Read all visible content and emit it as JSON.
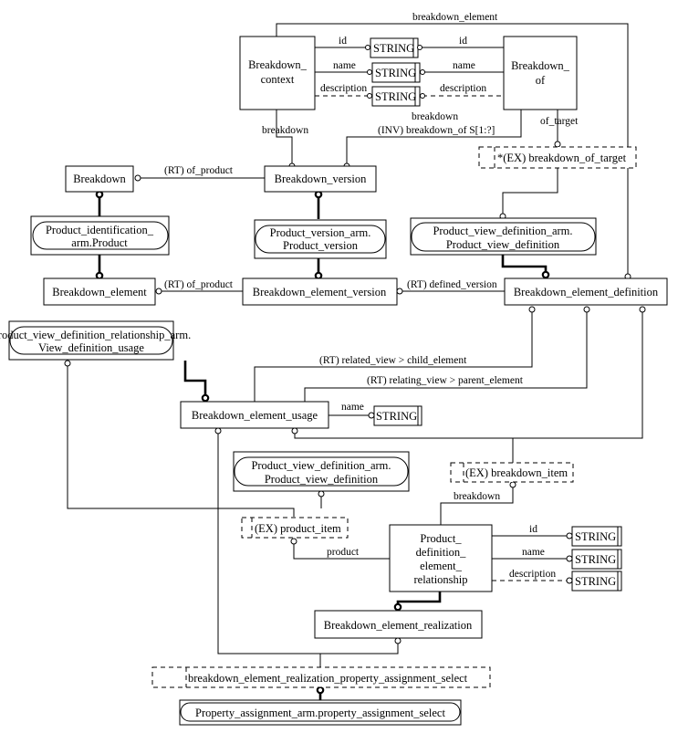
{
  "diagram": {
    "entities": {
      "breakdown_context": [
        "Breakdown_",
        "context"
      ],
      "breakdown_of": [
        "Breakdown_",
        "of"
      ],
      "breakdown": "Breakdown",
      "breakdown_version": "Breakdown_version",
      "breakdown_element": "Breakdown_element",
      "breakdown_element_version": "Breakdown_element_version",
      "breakdown_element_definition": "Breakdown_element_definition",
      "breakdown_element_usage": "Breakdown_element_usage",
      "pder": [
        "Product_",
        "definition_",
        "element_",
        "relationship"
      ],
      "breakdown_element_realization": "Breakdown_element_realization"
    },
    "references": {
      "product_identification": [
        "Product_identification_",
        "arm.Product"
      ],
      "product_version": [
        "Product_version_arm.",
        "Product_version"
      ],
      "pvd_top": [
        "Product_view_definition_arm.",
        "Product_view_definition"
      ],
      "pvdr": [
        "Product_view_definition_relationship_arm.",
        "View_definition_usage"
      ],
      "pvd_bottom": [
        "Product_view_definition_arm.",
        "Product_view_definition"
      ],
      "property_assignment": "Property_assignment_arm.property_assignment_select"
    },
    "selects": {
      "breakdown_of_target": "*(EX) breakdown_of_target",
      "breakdown_item": "(EX) breakdown_item",
      "product_item": "(EX) product_item",
      "berpas": "breakdown_element_realization_property_assignment_select"
    },
    "types": {
      "string": "STRING"
    },
    "labels": {
      "breakdown_element": "breakdown_element",
      "id": "id",
      "name": "name",
      "description": "description",
      "breakdown": "breakdown",
      "inv_breakdown_of": "(INV) breakdown_of S[1:?]",
      "of_target": "of_target",
      "rt_of_product": "(RT) of_product",
      "rt_defined_version": "(RT) defined_version",
      "rt_related_view": "(RT) related_view > child_element",
      "rt_relating_view": "(RT) relating_view > parent_element",
      "product": "product"
    }
  }
}
